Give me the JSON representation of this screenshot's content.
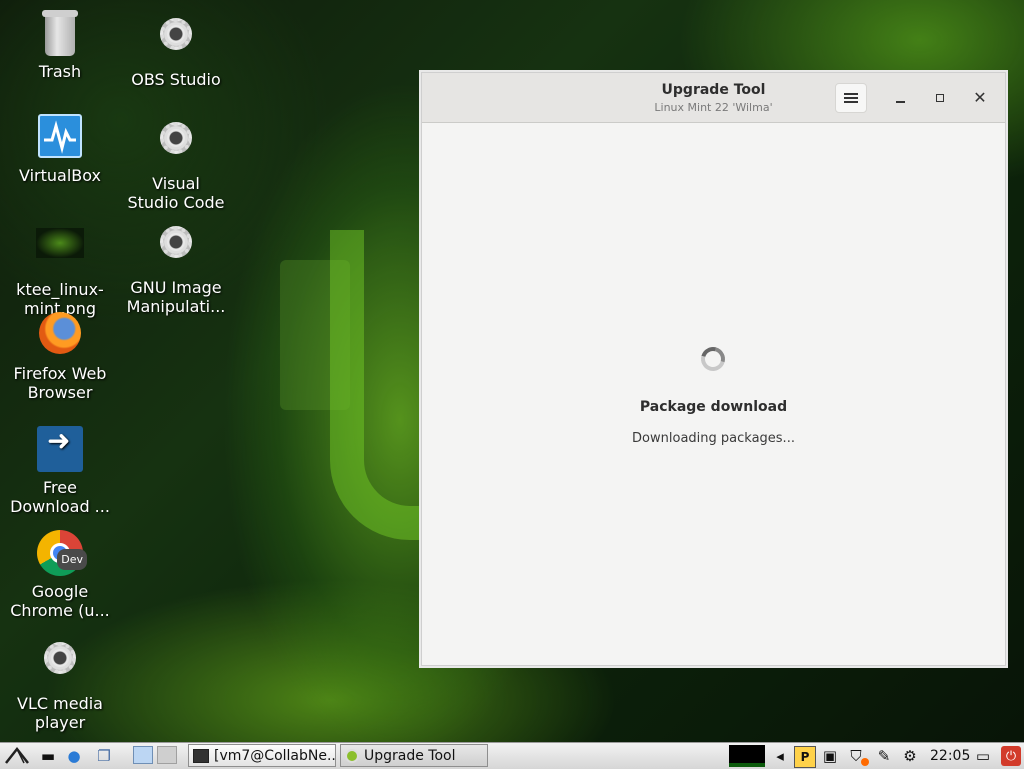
{
  "desktop": {
    "icons": [
      {
        "label": "Trash"
      },
      {
        "label": "OBS Studio"
      },
      {
        "label": "VirtualBox"
      },
      {
        "label": "Visual\nStudio Code"
      },
      {
        "label": "ktee_linux-\nmint.png"
      },
      {
        "label": "GNU Image\nManipulati..."
      },
      {
        "label": "Firefox Web\nBrowser"
      },
      {
        "label": "Free\nDownload ..."
      },
      {
        "label": "Google\nChrome (u...",
        "badge": "Dev"
      },
      {
        "label": "VLC media\nplayer"
      }
    ]
  },
  "window": {
    "title": "Upgrade Tool",
    "subtitle": "Linux Mint 22 'Wilma'",
    "step_title": "Package download",
    "step_status": "Downloading packages..."
  },
  "taskbar": {
    "tasks": [
      {
        "label": "[vm7@CollabNe..."
      },
      {
        "label": "Upgrade Tool"
      }
    ],
    "clock": "22:05",
    "tray_icons": [
      "cpu-graph",
      "network-icon",
      "p-icon",
      "clipboard-icon",
      "shield-update-icon",
      "usb-icon",
      "gear-icon",
      "display-icon",
      "power-icon"
    ],
    "accent_color": "#d23b2b"
  }
}
